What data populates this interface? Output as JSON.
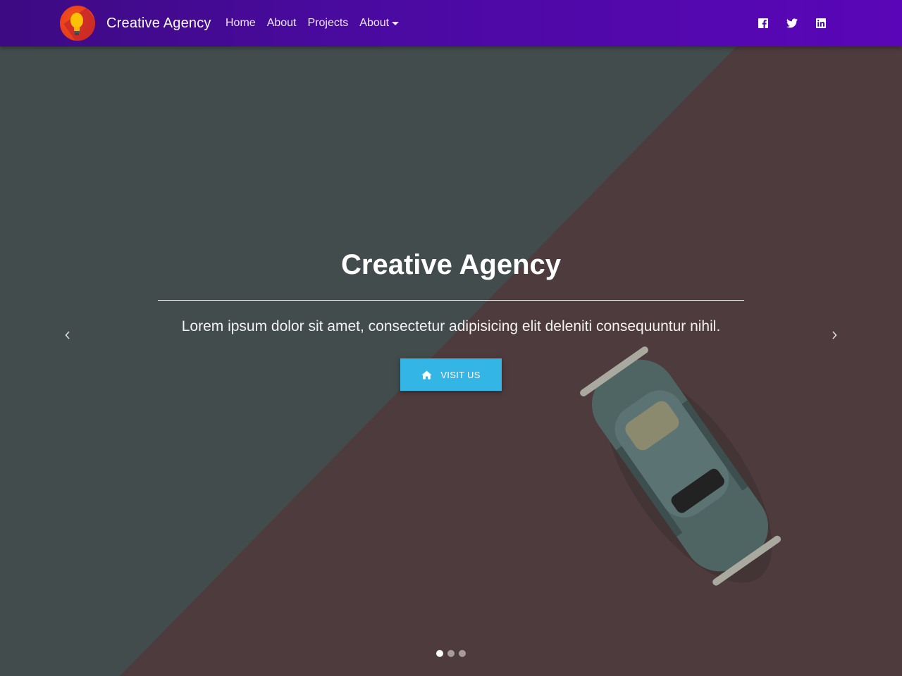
{
  "navbar": {
    "brand_name": "Creative Agency",
    "logo_icon": "lightbulb-icon",
    "links": [
      {
        "label": "Home"
      },
      {
        "label": "About"
      },
      {
        "label": "Projects"
      },
      {
        "label": "About",
        "dropdown": true
      }
    ],
    "social": [
      {
        "icon": "facebook-icon"
      },
      {
        "icon": "twitter-icon"
      },
      {
        "icon": "linkedin-icon"
      }
    ],
    "colors": {
      "gradient_start": "#3d0a82",
      "gradient_end": "#5a06b8"
    }
  },
  "carousel": {
    "slide": {
      "title": "Creative Agency",
      "text": "Lorem ipsum dolor sit amet, consectetur adipisicing elit deleniti consequuntur nihil.",
      "button_label": "VISIT US",
      "button_icon": "home-icon",
      "button_color": "#33b5e5"
    },
    "prev_icon": "chevron-left-icon",
    "next_icon": "chevron-right-icon",
    "indicators": [
      {
        "active": true
      },
      {
        "active": false
      },
      {
        "active": false
      }
    ],
    "background_colors": {
      "left": "#434c4c",
      "right": "#4e3b3d"
    }
  }
}
